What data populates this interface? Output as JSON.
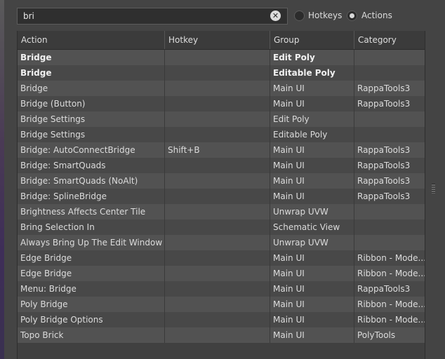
{
  "search": {
    "value": "bri"
  },
  "filter": {
    "hotkeys_label": "Hotkeys",
    "actions_label": "Actions",
    "selected": "Actions"
  },
  "columns": [
    "Action",
    "Hotkey",
    "Group",
    "Category"
  ],
  "rows": [
    {
      "action": "Bridge",
      "hotkey": "",
      "group": "Edit Poly",
      "category": "",
      "bold": true
    },
    {
      "action": "Bridge",
      "hotkey": "",
      "group": "Editable Poly",
      "category": "",
      "bold": true
    },
    {
      "action": "Bridge",
      "hotkey": "",
      "group": "Main UI",
      "category": "RappaTools3"
    },
    {
      "action": "Bridge (Button)",
      "hotkey": "",
      "group": "Main UI",
      "category": "RappaTools3"
    },
    {
      "action": "Bridge Settings",
      "hotkey": "",
      "group": "Edit Poly",
      "category": ""
    },
    {
      "action": "Bridge Settings",
      "hotkey": "",
      "group": "Editable Poly",
      "category": ""
    },
    {
      "action": "Bridge: AutoConnectBridge",
      "hotkey": "Shift+B",
      "group": "Main UI",
      "category": "RappaTools3"
    },
    {
      "action": "Bridge: SmartQuads",
      "hotkey": "",
      "group": "Main UI",
      "category": "RappaTools3"
    },
    {
      "action": "Bridge: SmartQuads (NoAlt)",
      "hotkey": "",
      "group": "Main UI",
      "category": "RappaTools3"
    },
    {
      "action": "Bridge: SplineBridge",
      "hotkey": "",
      "group": "Main UI",
      "category": "RappaTools3"
    },
    {
      "action": "Brightness Affects Center Tile",
      "hotkey": "",
      "group": "Unwrap UVW",
      "category": ""
    },
    {
      "action": "Bring Selection In",
      "hotkey": "",
      "group": "Schematic View",
      "category": ""
    },
    {
      "action": "Always Bring Up The Edit Window",
      "hotkey": "",
      "group": "Unwrap UVW",
      "category": ""
    },
    {
      "action": "Edge Bridge",
      "hotkey": "",
      "group": "Main UI",
      "category": "Ribbon - Mode..."
    },
    {
      "action": "Edge Bridge",
      "hotkey": "",
      "group": "Main UI",
      "category": "Ribbon - Mode..."
    },
    {
      "action": "Menu: Bridge",
      "hotkey": "",
      "group": "Main UI",
      "category": "RappaTools3"
    },
    {
      "action": "Poly Bridge",
      "hotkey": "",
      "group": "Main UI",
      "category": "Ribbon - Mode..."
    },
    {
      "action": "Poly Bridge Options",
      "hotkey": "",
      "group": "Main UI",
      "category": "Ribbon - Mode..."
    },
    {
      "action": "Topo Brick",
      "hotkey": "",
      "group": "Main UI",
      "category": "PolyTools"
    }
  ]
}
